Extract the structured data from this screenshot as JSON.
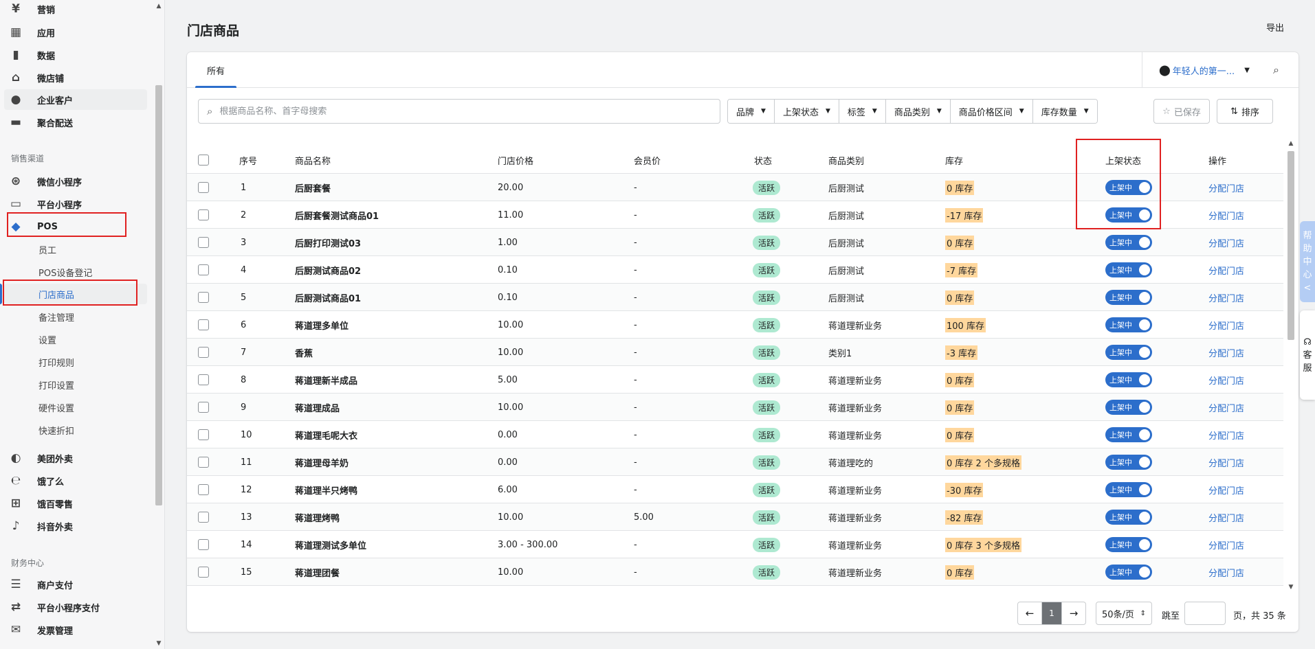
{
  "sidebar": {
    "top_items": [
      {
        "label": "营销",
        "icon": "marketing-icon"
      },
      {
        "label": "应用",
        "icon": "apps-icon"
      },
      {
        "label": "数据",
        "icon": "data-icon"
      },
      {
        "label": "微店铺",
        "icon": "store-icon"
      },
      {
        "label": "企业客户",
        "icon": "enterprise-customer-icon"
      },
      {
        "label": "聚合配送",
        "icon": "delivery-icon"
      }
    ],
    "section_sales": "销售渠道",
    "sales_items": [
      {
        "label": "微信小程序",
        "icon": "wechat-miniprogram-icon"
      },
      {
        "label": "平台小程序",
        "icon": "platform-miniprogram-icon"
      },
      {
        "label": "POS",
        "icon": "pos-bag-icon"
      }
    ],
    "pos_subitems": [
      "员工",
      "POS设备登记",
      "门店商品",
      "备注管理",
      "设置",
      "打印规则",
      "打印设置",
      "硬件设置",
      "快速折扣"
    ],
    "channel_items": [
      {
        "label": "美团外卖",
        "icon": "meituan-icon"
      },
      {
        "label": "饿了么",
        "icon": "eleme-icon"
      },
      {
        "label": "饿百零售",
        "icon": "ebai-basket-icon"
      },
      {
        "label": "抖音外卖",
        "icon": "douyin-icon"
      }
    ],
    "section_finance": "财务中心",
    "finance_items": [
      {
        "label": "商户支付",
        "icon": "merchant-payment-icon"
      },
      {
        "label": "平台小程序支付",
        "icon": "platform-payment-icon"
      },
      {
        "label": "发票管理",
        "icon": "invoice-icon"
      }
    ]
  },
  "header": {
    "title": "门店商品",
    "export_label": "导出"
  },
  "tabs": {
    "all": "所有"
  },
  "store_selector": {
    "label": "年轻人的第一..."
  },
  "search": {
    "placeholder": "根据商品名称、首字母搜索"
  },
  "filters": [
    "品牌",
    "上架状态",
    "标签",
    "商品类别",
    "商品价格区间",
    "库存数量"
  ],
  "saved_label": "已保存",
  "sort_label": "排序",
  "table": {
    "headers": {
      "index": "序号",
      "name": "商品名称",
      "price": "门店价格",
      "member_price": "会员价",
      "status": "状态",
      "category": "商品类别",
      "stock": "库存",
      "listing": "上架状态",
      "action": "操作"
    },
    "rows": [
      {
        "index": "1",
        "name": "后厨套餐",
        "price": "20.00",
        "member_price": "-",
        "status": "活跃",
        "category": "后厨测试",
        "stock": "0 库存",
        "stock_extra": "",
        "toggle": "上架中",
        "action": "分配门店"
      },
      {
        "index": "2",
        "name": "后厨套餐测试商品01",
        "price": "11.00",
        "member_price": "-",
        "status": "活跃",
        "category": "后厨测试",
        "stock": "-17 库存",
        "stock_extra": "",
        "toggle": "上架中",
        "action": "分配门店"
      },
      {
        "index": "3",
        "name": "后厨打印测试03",
        "price": "1.00",
        "member_price": "-",
        "status": "活跃",
        "category": "后厨测试",
        "stock": "0 库存",
        "stock_extra": "",
        "toggle": "上架中",
        "action": "分配门店"
      },
      {
        "index": "4",
        "name": "后厨测试商品02",
        "price": "0.10",
        "member_price": "-",
        "status": "活跃",
        "category": "后厨测试",
        "stock": "-7 库存",
        "stock_extra": "",
        "toggle": "上架中",
        "action": "分配门店"
      },
      {
        "index": "5",
        "name": "后厨测试商品01",
        "price": "0.10",
        "member_price": "-",
        "status": "活跃",
        "category": "后厨测试",
        "stock": "0 库存",
        "stock_extra": "",
        "toggle": "上架中",
        "action": "分配门店"
      },
      {
        "index": "6",
        "name": "蒋道理多单位",
        "price": "10.00",
        "member_price": "-",
        "status": "活跃",
        "category": "蒋道理新业务",
        "stock": "100 库存",
        "stock_extra": "",
        "toggle": "上架中",
        "action": "分配门店"
      },
      {
        "index": "7",
        "name": "香蕉",
        "price": "10.00",
        "member_price": "-",
        "status": "活跃",
        "category": "类别1",
        "stock": "-3 库存",
        "stock_extra": "",
        "toggle": "上架中",
        "action": "分配门店"
      },
      {
        "index": "8",
        "name": "蒋道理新半成品",
        "price": "5.00",
        "member_price": "-",
        "status": "活跃",
        "category": "蒋道理新业务",
        "stock": "0 库存",
        "stock_extra": "",
        "toggle": "上架中",
        "action": "分配门店"
      },
      {
        "index": "9",
        "name": "蒋道理成品",
        "price": "10.00",
        "member_price": "-",
        "status": "活跃",
        "category": "蒋道理新业务",
        "stock": "0 库存",
        "stock_extra": "",
        "toggle": "上架中",
        "action": "分配门店"
      },
      {
        "index": "10",
        "name": "蒋道理毛呢大衣",
        "price": "0.00",
        "member_price": "-",
        "status": "活跃",
        "category": "蒋道理新业务",
        "stock": "0 库存",
        "stock_extra": "",
        "toggle": "上架中",
        "action": "分配门店"
      },
      {
        "index": "11",
        "name": "蒋道理母羊奶",
        "price": "0.00",
        "member_price": "-",
        "status": "活跃",
        "category": "蒋道理吃的",
        "stock": "0 库存",
        "stock_extra": "2 个多规格",
        "toggle": "上架中",
        "action": "分配门店"
      },
      {
        "index": "12",
        "name": "蒋道理半只烤鸭",
        "price": "6.00",
        "member_price": "-",
        "status": "活跃",
        "category": "蒋道理新业务",
        "stock": "-30 库存",
        "stock_extra": "",
        "toggle": "上架中",
        "action": "分配门店"
      },
      {
        "index": "13",
        "name": "蒋道理烤鸭",
        "price": "10.00",
        "member_price": "5.00",
        "status": "活跃",
        "category": "蒋道理新业务",
        "stock": "-82 库存",
        "stock_extra": "",
        "toggle": "上架中",
        "action": "分配门店"
      },
      {
        "index": "14",
        "name": "蒋道理测试多单位",
        "price": "3.00 - 300.00",
        "member_price": "-",
        "status": "活跃",
        "category": "蒋道理新业务",
        "stock": "0 库存",
        "stock_extra": "3 个多规格",
        "toggle": "上架中",
        "action": "分配门店"
      },
      {
        "index": "15",
        "name": "蒋道理团餐",
        "price": "10.00",
        "member_price": "-",
        "status": "活跃",
        "category": "蒋道理新业务",
        "stock": "0 库存",
        "stock_extra": "",
        "toggle": "上架中",
        "action": "分配门店"
      }
    ]
  },
  "pagination": {
    "current_page": "1",
    "page_size": "50条/页",
    "jump_label": "跳至",
    "page_suffix": "页，",
    "total": "共 35 条"
  },
  "float_tabs": {
    "help": [
      "帮",
      "助",
      "中",
      "心",
      "<"
    ],
    "service": [
      "客",
      "服"
    ]
  },
  "colors": {
    "accent": "#2c6ecb",
    "status_badge": "#aee9d1",
    "stock_highlight": "#ffd79d",
    "highlight_box": "#e02020"
  }
}
